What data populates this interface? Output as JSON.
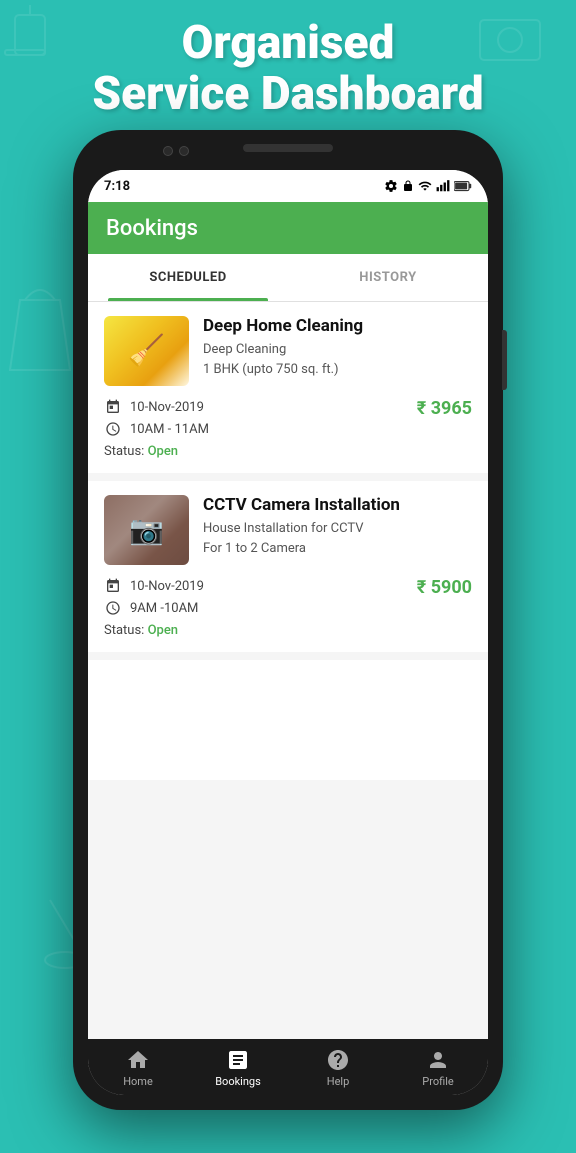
{
  "app": {
    "header_line1": "Organised",
    "header_line2": "Service Dashboard"
  },
  "status_bar": {
    "time": "7:18",
    "icons": [
      "gear",
      "lock",
      "wifi",
      "signal",
      "battery"
    ]
  },
  "app_bar": {
    "title": "Bookings"
  },
  "tabs": [
    {
      "id": "scheduled",
      "label": "SCHEDULED",
      "active": true
    },
    {
      "id": "history",
      "label": "HISTORY",
      "active": false
    }
  ],
  "bookings": [
    {
      "id": 1,
      "title": "Deep Home Cleaning",
      "sub_line1": "Deep Cleaning",
      "sub_line2": "1 BHK (upto 750 sq. ft.)",
      "date": "10-Nov-2019",
      "time": "10AM - 11AM",
      "price": "₹ 3965",
      "status_label": "Status:",
      "status_value": "Open",
      "image_type": "cleaning"
    },
    {
      "id": 2,
      "title": "CCTV Camera Installation",
      "sub_line1": "House Installation for CCTV",
      "sub_line2": "For 1 to 2 Camera",
      "date": "10-Nov-2019",
      "time": "9AM -10AM",
      "price": "₹ 5900",
      "status_label": "Status:",
      "status_value": "Open",
      "image_type": "cctv"
    }
  ],
  "bottom_nav": [
    {
      "id": "home",
      "label": "Home",
      "active": false
    },
    {
      "id": "bookings",
      "label": "Bookings",
      "active": true
    },
    {
      "id": "help",
      "label": "Help",
      "active": false
    },
    {
      "id": "profile",
      "label": "Profile",
      "active": false
    }
  ]
}
